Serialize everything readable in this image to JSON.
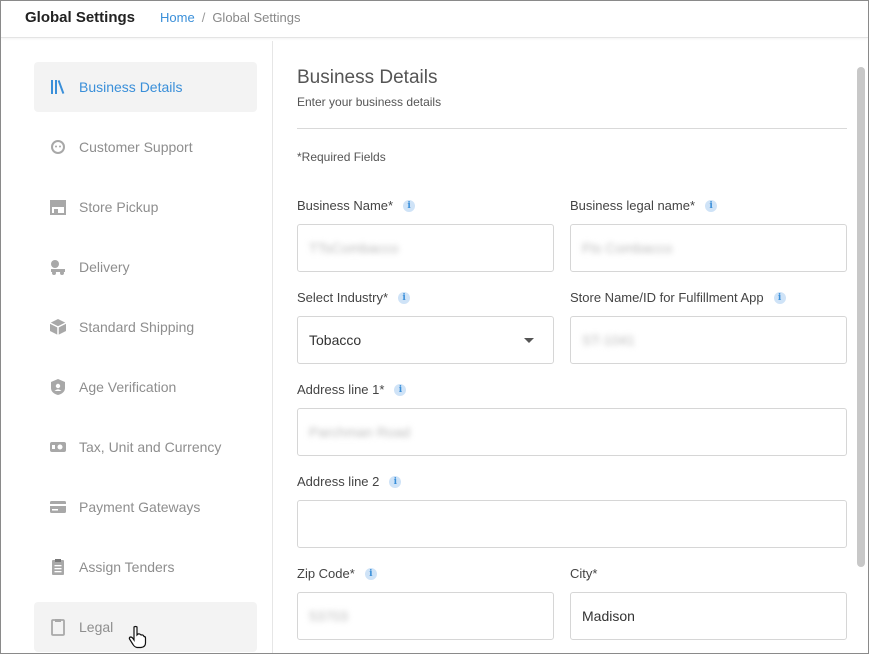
{
  "header": {
    "app_title": "Global Settings",
    "breadcrumb": {
      "home": "Home",
      "separator": "/",
      "current": "Global Settings"
    }
  },
  "sidebar": {
    "items": [
      {
        "label": "Business Details",
        "icon": "books-icon",
        "active": true
      },
      {
        "label": "Customer Support",
        "icon": "support-icon"
      },
      {
        "label": "Store Pickup",
        "icon": "store-icon"
      },
      {
        "label": "Delivery",
        "icon": "delivery-icon"
      },
      {
        "label": "Standard Shipping",
        "icon": "box-icon"
      },
      {
        "label": "Age Verification",
        "icon": "user-shield-icon"
      },
      {
        "label": "Tax, Unit and Currency",
        "icon": "cash-icon"
      },
      {
        "label": "Payment Gateways",
        "icon": "card-icon"
      },
      {
        "label": "Assign Tenders",
        "icon": "clipboard-list-icon"
      },
      {
        "label": "Legal",
        "icon": "clipboard-icon"
      }
    ]
  },
  "main": {
    "title": "Business Details",
    "subtitle": "Enter your business details",
    "required_note": "*Required Fields",
    "fields": {
      "business_name": {
        "label": "Business Name*",
        "value": "TTsCombacco"
      },
      "business_legal_name": {
        "label": "Business legal name*",
        "value": "Fts Combacco"
      },
      "industry": {
        "label": "Select Industry*",
        "value": "Tobacco"
      },
      "store_id": {
        "label": "Store Name/ID for Fulfillment App",
        "value": "ST-1041"
      },
      "address1": {
        "label": "Address line 1*",
        "value": "Parchman Road"
      },
      "address2": {
        "label": "Address line 2",
        "value": ""
      },
      "zip": {
        "label": "Zip Code*",
        "value": "53703"
      },
      "city": {
        "label": "City*",
        "value": "Madison"
      }
    },
    "info_glyph": "i"
  },
  "colors": {
    "accent": "#3a8fd9",
    "active_bg": "#f3f3f3",
    "info_bg": "#cfe3f7"
  }
}
